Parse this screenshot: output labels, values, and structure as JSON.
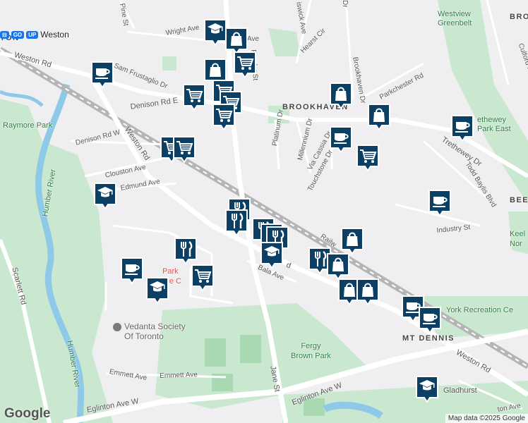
{
  "roads": {
    "wright_ave": "Wright Ave",
    "pine_st": "Pine St",
    "weston_rd_top": "Weston Rd",
    "sam_frustaglio_dr": "Sam Frustaglio Dr",
    "denison_rd_e": "Denison Rd E",
    "denison_rd_w": "Denison Rd W",
    "weston_rd_mid": "Weston Rd",
    "clouston_ave": "Clouston Ave",
    "edmund_ave": "Edmund Ave",
    "hearst_cir": "Hearst Cir",
    "chiswick_ave": "iswick Ave",
    "brookhaven_dr": "Brookhaven Dr",
    "brookhaven_dr_top": "Dr",
    "parkchester_rd": "Parkchester Rd",
    "platinum_dr": "Platinum Dr",
    "millennium_dr": "Millennium Dr",
    "via_cassia_dr": "Via Cassia Dr",
    "touchstone_dr": "Touchstone Dr",
    "trethewey_dr": "Trethewey Dr",
    "todd_baylis_blvd": "Todd Baylis Blvd",
    "culford_rd": "Culford Rd",
    "industry_st": "Industry St",
    "railway": "Railw",
    "bala_ave": "Bala Ave",
    "rd_fragment": "d",
    "scarlett_rd": "Scarlett Rd",
    "emmett_ave_left": "Emmett Ave",
    "emmett_ave_right": "Emmett Ave",
    "jane_st": "Jane St",
    "eglinton_ave_w_left": "Eglinton Ave W",
    "eglinton_ave_w_right": "Eglinton Ave W",
    "weston_rd_bottom": "Weston Rd",
    "ton_ave": "ton Ave",
    "feeder_st": "Feeder St",
    "st_fragment": "Ave"
  },
  "areas": {
    "brookhaven": "BROOKHAVEN",
    "mt_dennis": "MT DENNIS",
    "westview_greenbelt": "Westview\nGreenbelt",
    "trethewey_park_east": "ethewey\nPark East",
    "raymore_park": "Raymore Park",
    "humber_river_top": "Humber River",
    "humber_river_bottom": "Humber River",
    "fergy_brown_park": "Fergy\nBrown Park",
    "york_recreation": "York Recreation Ce",
    "vedanta_society": "Vedanta Society\nOf Toronto",
    "bro": "BRO",
    "bee": "BEE",
    "keel": "Keel",
    "nor": "Nor",
    "gladhurst": "Gladhurst",
    "red_poi": "Park\nare C",
    "ton": "TON"
  },
  "transit": {
    "station": "Weston"
  },
  "markers": [
    {
      "type": "school",
      "icon": "school-icon"
    },
    {
      "type": "shopping",
      "icon": "shopping-bag-icon"
    },
    {
      "type": "grocery",
      "icon": "shopping-cart-icon"
    },
    {
      "type": "cafe",
      "icon": "coffee-cup-icon"
    },
    {
      "type": "shopping",
      "icon": "shopping-bag-icon"
    },
    {
      "type": "grocery",
      "icon": "shopping-cart-icon"
    },
    {
      "type": "grocery",
      "icon": "shopping-cart-icon"
    },
    {
      "type": "grocery",
      "icon": "shopping-cart-icon"
    },
    {
      "type": "grocery",
      "icon": "shopping-cart-icon"
    },
    {
      "type": "shopping",
      "icon": "shopping-bag-icon"
    },
    {
      "type": "shopping",
      "icon": "shopping-bag-icon"
    },
    {
      "type": "cafe",
      "icon": "coffee-cup-icon"
    },
    {
      "type": "grocery",
      "icon": "shopping-cart-icon"
    },
    {
      "type": "cafe",
      "icon": "coffee-cup-icon"
    },
    {
      "type": "grocery",
      "icon": "shopping-cart-icon"
    },
    {
      "type": "grocery",
      "icon": "shopping-cart-icon"
    },
    {
      "type": "school",
      "icon": "school-icon"
    },
    {
      "type": "cafe",
      "icon": "coffee-cup-icon"
    },
    {
      "type": "restaurant",
      "icon": "fork-knife-icon"
    },
    {
      "type": "restaurant",
      "icon": "fork-knife-icon"
    },
    {
      "type": "restaurant",
      "icon": "fork-knife-icon"
    },
    {
      "type": "restaurant",
      "icon": "fork-knife-icon"
    },
    {
      "type": "restaurant",
      "icon": "fork-knife-icon"
    },
    {
      "type": "school",
      "icon": "school-icon"
    },
    {
      "type": "shopping",
      "icon": "shopping-bag-icon"
    },
    {
      "type": "restaurant",
      "icon": "fork-knife-icon"
    },
    {
      "type": "shopping",
      "icon": "shopping-bag-icon"
    },
    {
      "type": "shopping",
      "icon": "shopping-bag-icon"
    },
    {
      "type": "shopping",
      "icon": "shopping-bag-icon"
    },
    {
      "type": "restaurant",
      "icon": "fork-knife-icon"
    },
    {
      "type": "cafe",
      "icon": "coffee-cup-icon"
    },
    {
      "type": "grocery",
      "icon": "shopping-cart-icon"
    },
    {
      "type": "school",
      "icon": "school-icon"
    },
    {
      "type": "cafe",
      "icon": "coffee-cup-icon"
    },
    {
      "type": "cafe",
      "icon": "coffee-cup-icon"
    },
    {
      "type": "school",
      "icon": "school-icon"
    }
  ],
  "colors": {
    "marker_fill": "#0b3f63",
    "marker_border": "#ffffff",
    "park_green": "#c9e8cf",
    "water": "#8ec9e8",
    "road": "#ffffff",
    "rail": "#b5b5b8"
  },
  "attribution": {
    "logo": "Google",
    "text": "Map data ©2025 Google"
  }
}
